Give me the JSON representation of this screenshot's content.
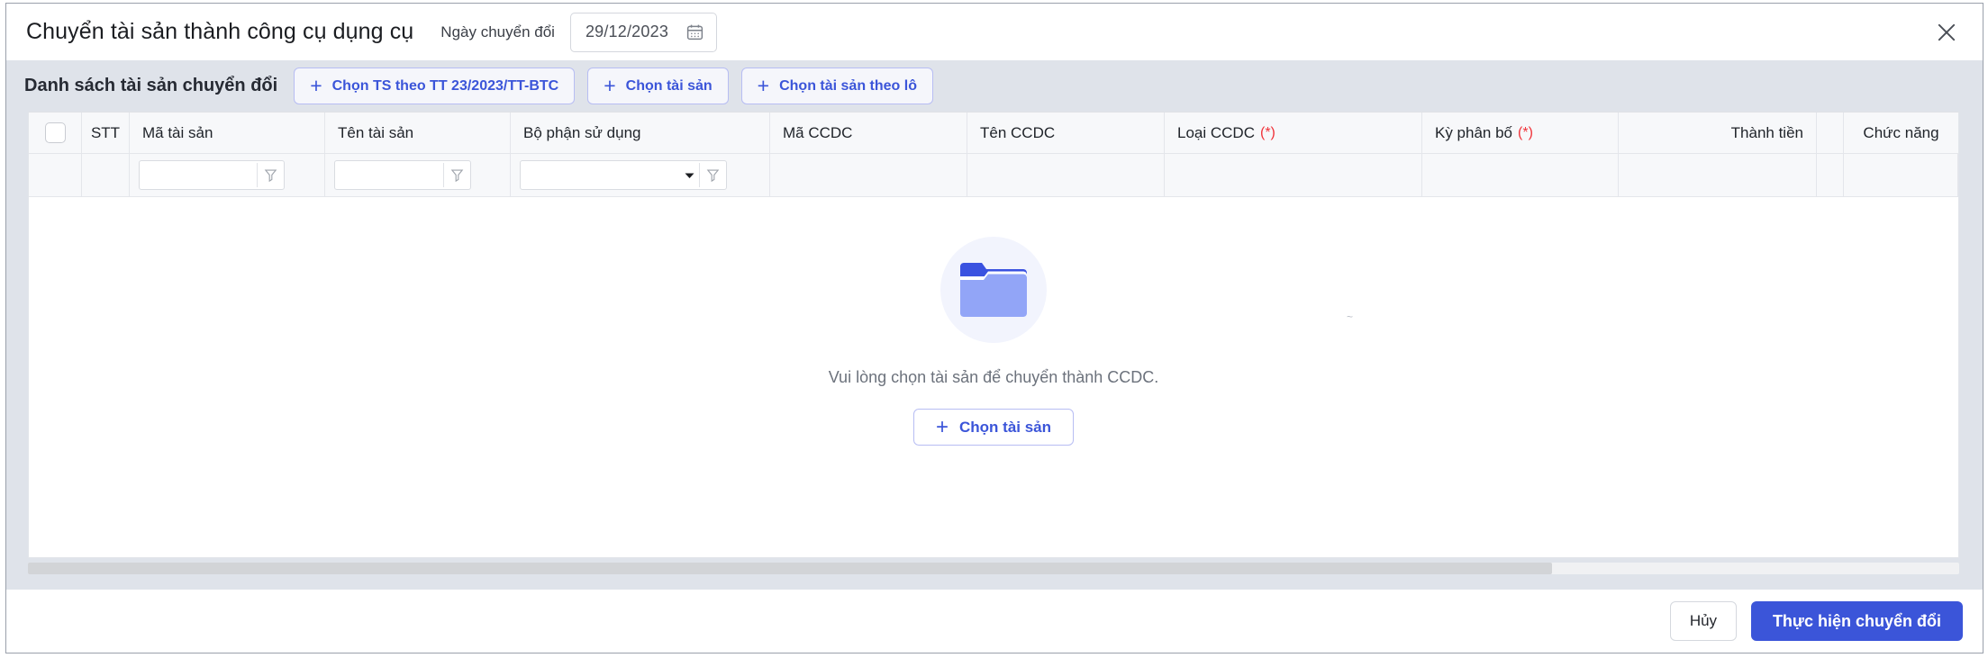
{
  "header": {
    "title": "Chuyển tài sản thành công cụ dụng cụ",
    "date_label": "Ngày chuyển đổi",
    "date_value": "29/12/2023",
    "calendar_icon": "calendar-icon",
    "close_icon": "close-icon"
  },
  "toolbar": {
    "title": "Danh sách tài sản chuyển đổi",
    "buttons": [
      {
        "label": "Chọn TS theo TT 23/2023/TT-BTC",
        "icon": "plus-icon"
      },
      {
        "label": "Chọn tài sản",
        "icon": "plus-icon"
      },
      {
        "label": "Chọn tài sản theo lô",
        "icon": "plus-icon"
      }
    ]
  },
  "table": {
    "columns": [
      {
        "key": "check",
        "label": ""
      },
      {
        "key": "stt",
        "label": "STT"
      },
      {
        "key": "ma_ts",
        "label": "Mã tài sản"
      },
      {
        "key": "ten_ts",
        "label": "Tên tài sản"
      },
      {
        "key": "bo_phan",
        "label": "Bộ phận sử dụng"
      },
      {
        "key": "ma_ccdc",
        "label": "Mã CCDC"
      },
      {
        "key": "ten_ccdc",
        "label": "Tên CCDC"
      },
      {
        "key": "loai_ccdc",
        "label": "Loại CCDC",
        "required": "(*)"
      },
      {
        "key": "ky_phan_bo",
        "label": "Kỳ phân bố",
        "required": "(*)"
      },
      {
        "key": "thanh_tien",
        "label": "Thành tiền"
      },
      {
        "key": "narrow",
        "label": ""
      },
      {
        "key": "chuc_nang",
        "label": "Chức năng"
      }
    ],
    "filters": {
      "ma_ts": {
        "value": "",
        "placeholder": "",
        "funnel_icon": "filter-funnel-icon"
      },
      "ten_ts": {
        "value": "",
        "placeholder": "",
        "funnel_icon": "filter-funnel-icon"
      },
      "bo_phan": {
        "value": "",
        "placeholder": "",
        "caret_icon": "caret-down-icon",
        "funnel_icon": "filter-funnel-icon"
      }
    },
    "rows": [],
    "header_checkbox": "unchecked"
  },
  "empty_state": {
    "icon": "folder-icon",
    "message": "Vui lòng chọn tài sản để chuyển thành CCDC.",
    "button_label": "Chọn tài sản",
    "button_icon": "plus-icon",
    "artifact": "~"
  },
  "scrollbar": {
    "orientation": "horizontal"
  },
  "footer": {
    "cancel_label": "Hủy",
    "submit_label": "Thực hiện chuyển đổi"
  },
  "colors": {
    "accent": "#3b55d9",
    "band": "#dfe3ea",
    "required": "#f0333a",
    "folder_light": "#92a5f7",
    "folder_dark": "#3a52e0"
  }
}
